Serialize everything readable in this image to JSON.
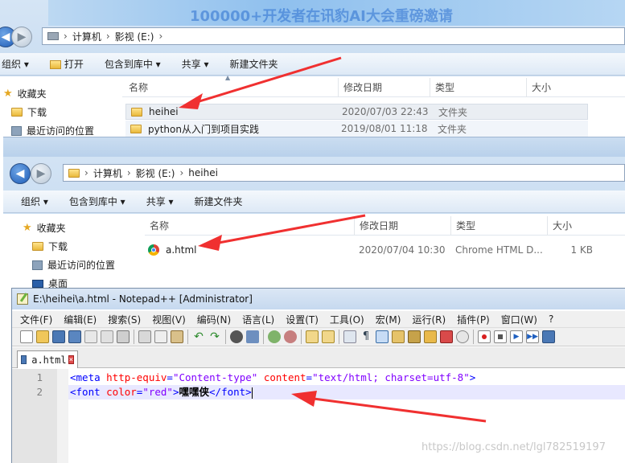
{
  "banner": {
    "text": "100000+开发者在讯豹AI大会重磅邀请"
  },
  "explorer1": {
    "path": [
      "计算机",
      "影视 (E:)"
    ],
    "toolbar": [
      "组织 ▾",
      "打开",
      "包含到库中 ▾",
      "共享 ▾",
      "新建文件夹"
    ],
    "sidebar": [
      "收藏夹",
      "下载",
      "最近访问的位置"
    ],
    "columns": [
      "名称",
      "修改日期",
      "类型",
      "大小"
    ],
    "rows": [
      {
        "name": "heihei",
        "date": "2020/07/03 22:43",
        "type": "文件夹"
      },
      {
        "name": "python从入门到项目实践",
        "date": "2019/08/01 11:18",
        "type": "文件夹"
      }
    ]
  },
  "explorer2": {
    "path": [
      "计算机",
      "影视 (E:)",
      "heihei"
    ],
    "toolbar": [
      "组织 ▾",
      "包含到库中 ▾",
      "共享 ▾",
      "新建文件夹"
    ],
    "sidebar": [
      "收藏夹",
      "下载",
      "最近访问的位置",
      "桌面"
    ],
    "columns": [
      "名称",
      "修改日期",
      "类型",
      "大小"
    ],
    "file": {
      "name": "a.html",
      "date": "2020/07/04 10:30",
      "type": "Chrome HTML D...",
      "size": "1 KB"
    }
  },
  "notepad": {
    "title": "E:\\heihei\\a.html - Notepad++ [Administrator]",
    "menu": [
      "文件(F)",
      "编辑(E)",
      "搜索(S)",
      "视图(V)",
      "编码(N)",
      "语言(L)",
      "设置(T)",
      "工具(O)",
      "宏(M)",
      "运行(R)",
      "插件(P)",
      "窗口(W)",
      "?"
    ],
    "tab": "a.html",
    "line_numbers": [
      "1",
      "2"
    ],
    "code": {
      "l1": {
        "t1": "<meta ",
        "a1": "http-equiv",
        "e1": "=",
        "v1": "\"Content-type\"",
        "sp1": " ",
        "a2": "content",
        "e2": "=",
        "v2": "\"text/html; charset=utf-8\"",
        "t2": ">"
      },
      "l2": {
        "t1": "<font ",
        "a1": "color",
        "e1": "=",
        "v1": "\"red\"",
        "t2": ">",
        "txt": "嘿嘿侠",
        "t3": "</font>"
      }
    }
  },
  "watermark": "https://blog.csdn.net/lgl782519197"
}
